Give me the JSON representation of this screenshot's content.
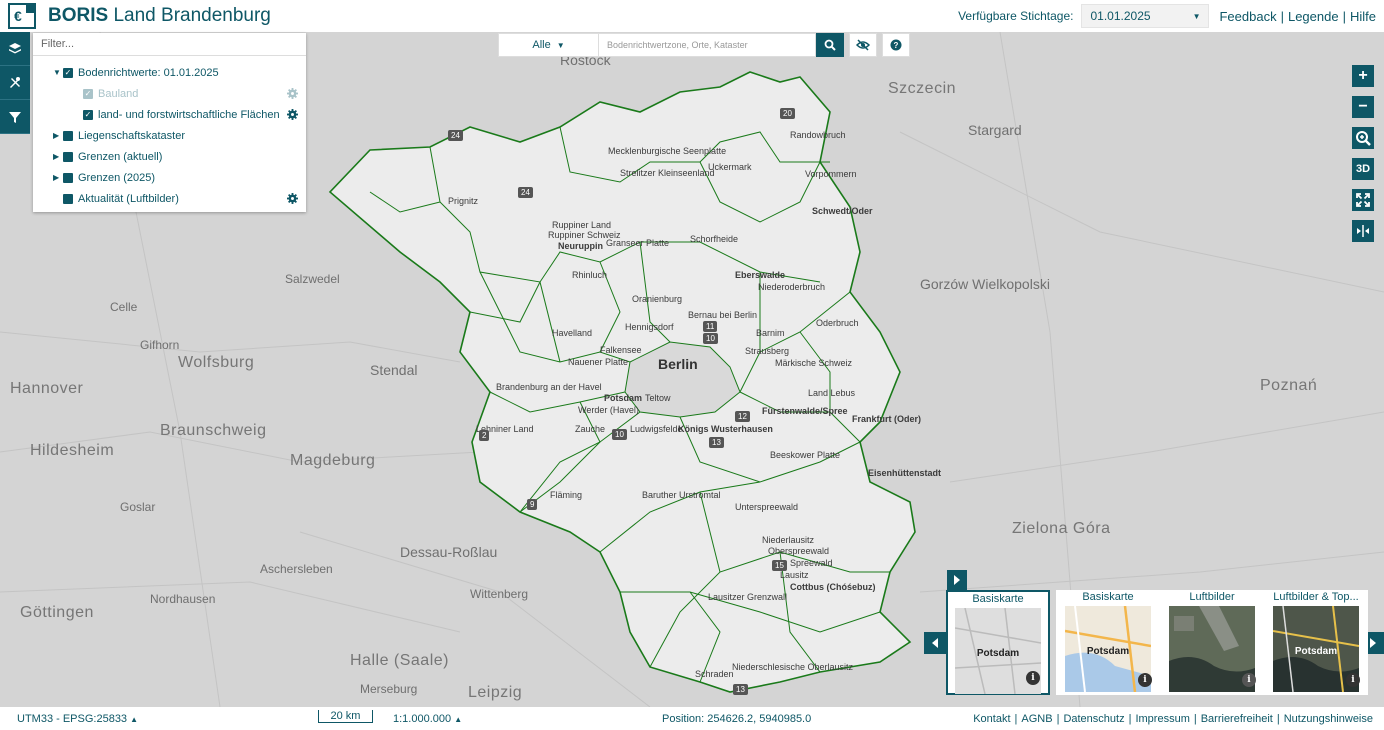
{
  "header": {
    "title_bold": "BORIS",
    "title_rest": "Land Brandenburg",
    "stichtag_label": "Verfügbare Stichtage:",
    "stichtag_value": "01.01.2025",
    "links": [
      "Feedback",
      "Legende",
      "Hilfe"
    ]
  },
  "layer_panel": {
    "filter_placeholder": "Filter...",
    "items": [
      {
        "label": "Bodenrichtwerte: 01.01.2025",
        "level": 0,
        "expanded": true,
        "checked": true
      },
      {
        "label": "Bauland",
        "level": 1,
        "checked": true,
        "disabled": true,
        "has_settings": true
      },
      {
        "label": "land- und forstwirtschaftliche Flächen",
        "level": 1,
        "checked": true,
        "has_settings": true
      },
      {
        "label": "Liegenschaftskataster",
        "level": 0,
        "expanded": false
      },
      {
        "label": "Grenzen (aktuell)",
        "level": 0,
        "expanded": false
      },
      {
        "label": "Grenzen (2025)",
        "level": 0,
        "expanded": false
      },
      {
        "label": "Aktualität (Luftbilder)",
        "level": 0,
        "has_settings": true
      }
    ]
  },
  "search": {
    "scope_label": "Alle",
    "placeholder": "Bodenrichtwertzone, Orte, Kataster"
  },
  "controls": {
    "label_3d": "3D"
  },
  "map": {
    "outer_labels": [
      "Szczecin",
      "Stargard",
      "Gorzów Wielkopolski",
      "Poznań",
      "Zielona Góra",
      "Hannover",
      "Wolfsburg",
      "Braunschweig",
      "Hildesheim",
      "Magdeburg",
      "Dessau-Roßlau",
      "Göttingen",
      "Halle (Saale)",
      "Leipzig",
      "Rostock",
      "Salzwedel",
      "Stendal",
      "Gifhorn",
      "Celle",
      "Goslar",
      "Nordhausen",
      "Aschersleben",
      "Wittenberg",
      "Merseburg"
    ],
    "inner_labels": [
      "Randowbruch",
      "Uckermark",
      "Vorpommern",
      "Mecklenburgische Seenplatte",
      "Strelitzer Kleinseenland",
      "Prignitz",
      "Ruppiner Land",
      "Ruppiner Schweiz",
      "Neuruppin",
      "Granseer Platte",
      "Schorfheide",
      "Schwedt/Oder",
      "Rhinluch",
      "Eberswalde",
      "Niederoderbruch",
      "Oranienburg",
      "Havelland",
      "Bernau bei Berlin",
      "Barnim",
      "Oderbruch",
      "Strausberg",
      "Märkische Schweiz",
      "Brandenburg an der Havel",
      "Potsdam",
      "Teltow",
      "Werder (Havel)",
      "Land Lebus",
      "Frankfurt (Oder)",
      "Fürstenwalde/Spree",
      "Ludwigsfelde",
      "Königs Wusterhausen",
      "Zauche",
      "Beeskower Platte",
      "Eisenhüttenstadt",
      "Fläming",
      "Baruther Urstromtal",
      "Unterspreewald",
      "Niederlausitz",
      "Oberspreewald",
      "Spreewald",
      "Cottbus (Chóśebuz)",
      "Lausitzer Grenzwall",
      "Schraden",
      "Niederschlesische Oberlausitz",
      "Lausitz",
      "Lehniner Land",
      "Hennigsdorf",
      "Falkensee",
      "Nauener Platte"
    ],
    "city": "Berlin",
    "road_numbers": [
      "24",
      "20",
      "24",
      "11",
      "10",
      "2",
      "10",
      "12",
      "13",
      "9",
      "15",
      "13"
    ]
  },
  "basemaps": [
    {
      "label": "Basiskarte",
      "city": "Potsdam",
      "active": true
    },
    {
      "label": "Basiskarte",
      "city": "Potsdam",
      "active": false
    },
    {
      "label": "Luftbilder",
      "city": "",
      "active": false
    },
    {
      "label": "Luftbilder & Top...",
      "city": "Potsdam",
      "active": false
    }
  ],
  "footer": {
    "crs": "UTM33 - EPSG:25833",
    "scale_bar": "20 km",
    "scale_ratio": "1:1.000.000",
    "position": "Position: 254626.2, 5940985.0",
    "links": [
      "Kontakt",
      "AGNB",
      "Datenschutz",
      "Impressum",
      "Barrierefreiheit",
      "Nutzungshinweise"
    ]
  },
  "colors": {
    "primary": "#0e5766",
    "boundary": "#1a7a1a",
    "map_bg": "#d4d4d4",
    "state_fill": "#eeeeee"
  },
  "icons": [
    "layers-icon",
    "tools-icon",
    "filter-icon",
    "search-icon",
    "eye-slash-icon",
    "help-icon",
    "gear-icon",
    "zoom-in-icon",
    "zoom-out-icon",
    "zoom-extent-icon",
    "fullscreen-icon",
    "split-icon",
    "info-icon"
  ]
}
